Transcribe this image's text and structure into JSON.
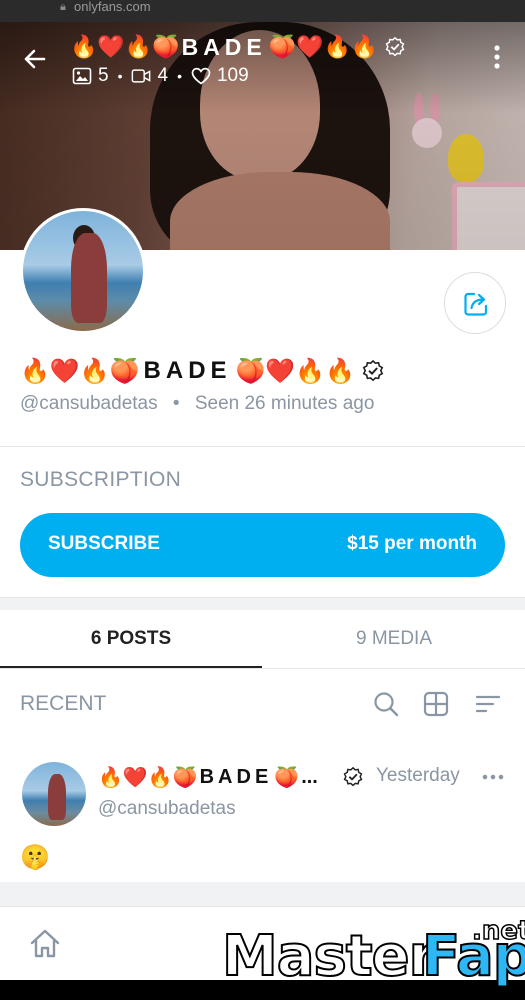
{
  "browser": {
    "url": "onlyfans.com"
  },
  "header": {
    "title_prefix_emoji": "🔥❤️🔥🍑",
    "title_name": "BADE",
    "title_suffix_emoji": "🍑❤️🔥🔥",
    "photos_count": "5",
    "videos_count": "4",
    "likes_count": "109",
    "stat_separator": "•"
  },
  "profile": {
    "name_prefix_emoji": "🔥❤️🔥🍑",
    "name": "BADE",
    "name_suffix_emoji": "🍑❤️🔥🔥",
    "handle": "@cansubadetas",
    "separator": "•",
    "last_seen": "Seen  26 minutes ago"
  },
  "subscription": {
    "heading": "SUBSCRIPTION",
    "button_label": "SUBSCRIBE",
    "price": "$15 per month",
    "accent_color": "#00aff0"
  },
  "tabs": [
    {
      "label": "6 POSTS",
      "active": true
    },
    {
      "label": "9 MEDIA",
      "active": false
    }
  ],
  "recent": {
    "heading": "RECENT",
    "tools": [
      "search-icon",
      "grid-icon",
      "sort-icon"
    ]
  },
  "post": {
    "author_prefix_emoji": "🔥❤️🔥🍑",
    "author_name": "BADE",
    "author_suffix_emoji": "🍑",
    "ellipsis": "...",
    "time": "Yesterday",
    "handle": "@cansubadetas",
    "text": "🤫"
  },
  "nav": {
    "home_icon": "home-icon"
  },
  "watermark": {
    "part1": "Master",
    "part2": "Fap",
    "part3": ".net"
  }
}
